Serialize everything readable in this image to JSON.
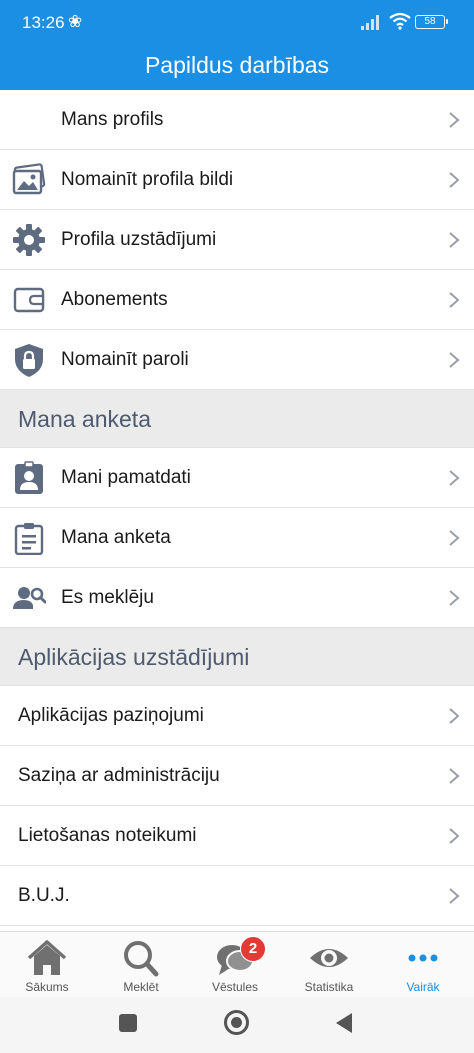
{
  "status_bar": {
    "time": "13:26",
    "fan_glyph": "❀",
    "battery": "58"
  },
  "header": {
    "title": "Papildus darbības"
  },
  "profile_section": [
    {
      "label": "Mans profils",
      "icon": "none"
    },
    {
      "label": "Nomainīt profila bildi",
      "icon": "picture-icon"
    },
    {
      "label": "Profila uzstādījumi",
      "icon": "gear-icon"
    },
    {
      "label": "Abonements",
      "icon": "wallet-icon"
    },
    {
      "label": "Nomainīt paroli",
      "icon": "shield-lock-icon"
    }
  ],
  "anketa_section": {
    "title": "Mana anketa",
    "items": [
      {
        "label": "Mani pamatdati",
        "icon": "id-badge-icon"
      },
      {
        "label": "Mana anketa",
        "icon": "clipboard-icon"
      },
      {
        "label": "Es meklēju",
        "icon": "user-search-icon"
      }
    ]
  },
  "app_section": {
    "title": "Aplikācijas uzstādījumi",
    "items": [
      {
        "label": "Aplikācijas paziņojumi"
      },
      {
        "label": "Saziņa ar administrāciju"
      },
      {
        "label": "Lietošanas noteikumi"
      },
      {
        "label": "B.U.J."
      }
    ]
  },
  "bottom_nav": [
    {
      "label": "Sākums",
      "icon": "home-icon"
    },
    {
      "label": "Meklēt",
      "icon": "search-icon"
    },
    {
      "label": "Vēstules",
      "icon": "chat-icon",
      "badge": "2"
    },
    {
      "label": "Statistika",
      "icon": "eye-icon"
    },
    {
      "label": "Vairāk",
      "icon": "more-icon",
      "active": true
    }
  ],
  "colors": {
    "primary": "#1a8fe3",
    "icon_gray": "#5f6b80",
    "section_bg": "#ebebeb",
    "badge": "#e53935"
  }
}
